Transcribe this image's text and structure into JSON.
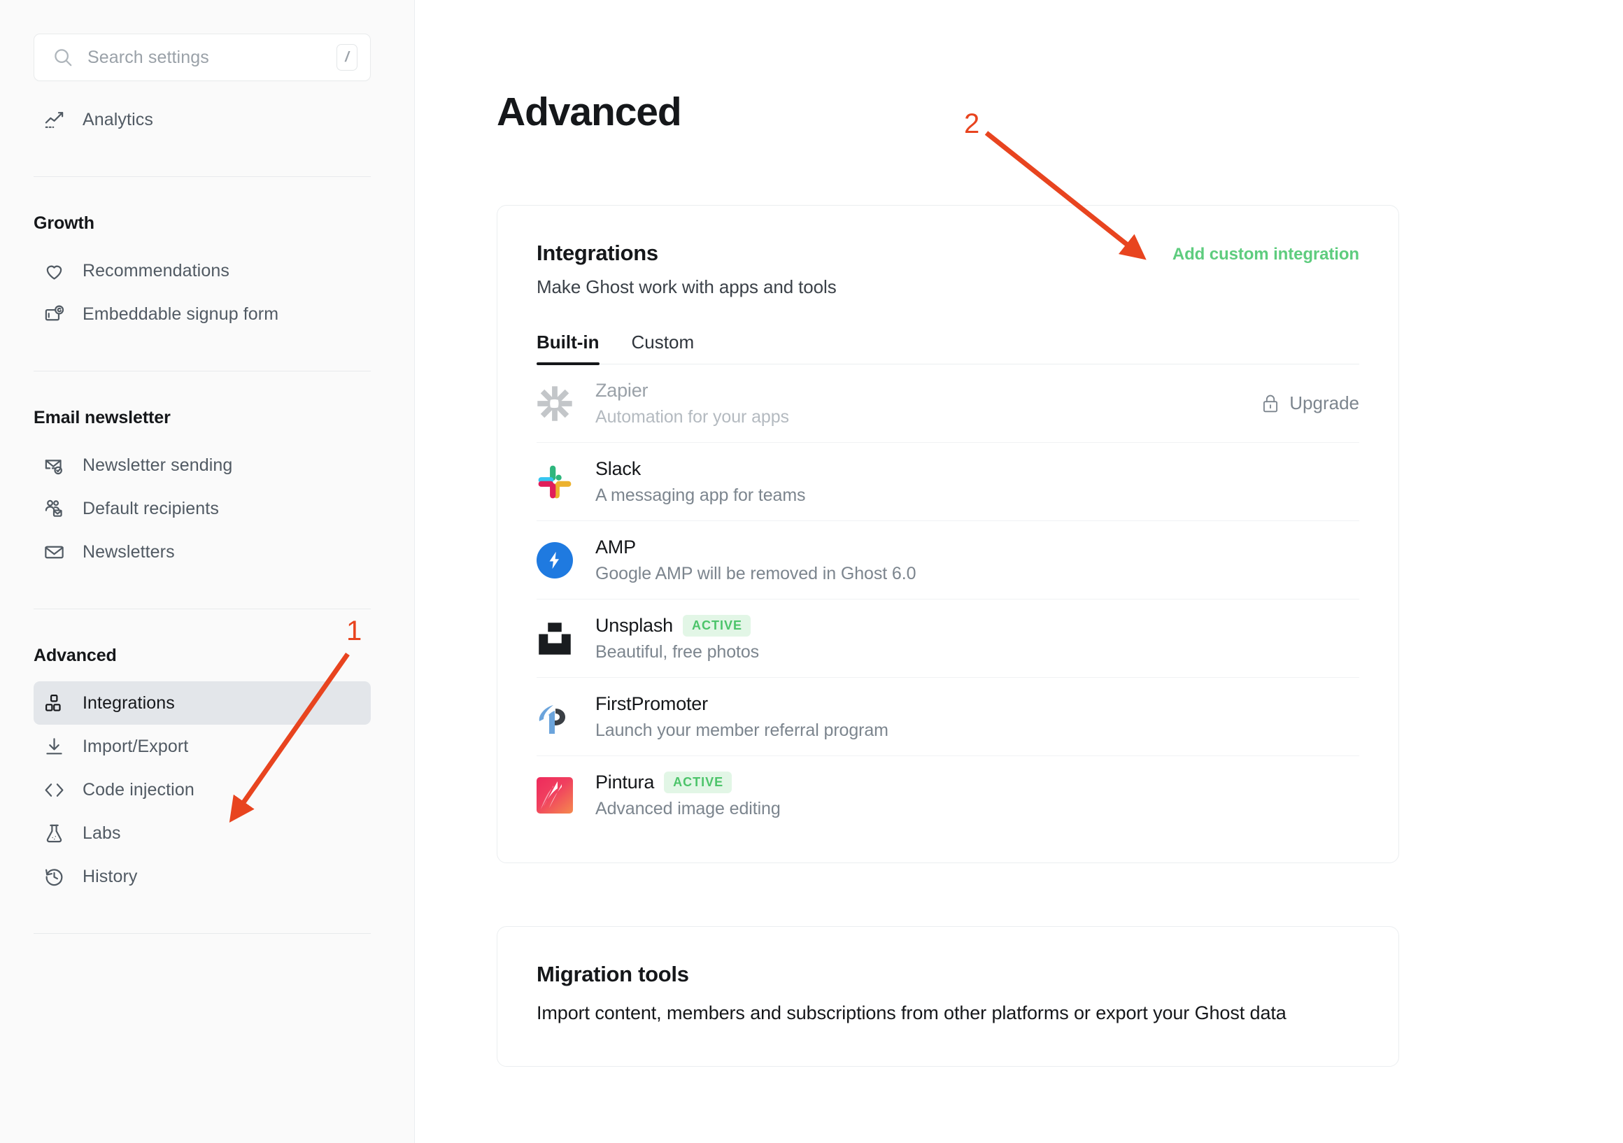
{
  "search": {
    "placeholder": "Search settings",
    "shortcut_key": "/",
    "icon": "search-icon"
  },
  "sidebar": {
    "top_items": [
      {
        "label": "Analytics",
        "icon": "analytics-chart-icon"
      }
    ],
    "sections": [
      {
        "title": "Growth",
        "items": [
          {
            "label": "Recommendations",
            "icon": "heart-icon"
          },
          {
            "label": "Embeddable signup form",
            "icon": "signup-form-icon"
          }
        ]
      },
      {
        "title": "Email newsletter",
        "items": [
          {
            "label": "Newsletter sending",
            "icon": "envelope-check-icon"
          },
          {
            "label": "Default recipients",
            "icon": "users-envelope-icon"
          },
          {
            "label": "Newsletters",
            "icon": "envelope-icon"
          }
        ]
      },
      {
        "title": "Advanced",
        "items": [
          {
            "label": "Integrations",
            "icon": "blocks-icon",
            "selected": true
          },
          {
            "label": "Import/Export",
            "icon": "download-icon"
          },
          {
            "label": "Code injection",
            "icon": "code-brackets-icon"
          },
          {
            "label": "Labs",
            "icon": "flask-icon"
          },
          {
            "label": "History",
            "icon": "clock-rewind-icon"
          }
        ]
      }
    ]
  },
  "main": {
    "page_title": "Advanced",
    "integrations_card": {
      "title": "Integrations",
      "subtitle": "Make Ghost work with apps and tools",
      "action_label": "Add custom integration",
      "action_color": "#5ecc7e",
      "tabs": [
        {
          "label": "Built-in",
          "active": true
        },
        {
          "label": "Custom",
          "active": false
        }
      ],
      "rows": [
        {
          "name": "Zapier",
          "description": "Automation for your apps",
          "icon": "zapier-logo",
          "disabled": true,
          "badge": "",
          "right_label": "Upgrade",
          "right_icon": "lock-icon"
        },
        {
          "name": "Slack",
          "description": "A messaging app for teams",
          "icon": "slack-logo",
          "disabled": false,
          "badge": "",
          "right_label": "",
          "right_icon": ""
        },
        {
          "name": "AMP",
          "description": "Google AMP will be removed in Ghost 6.0",
          "icon": "amp-logo",
          "disabled": false,
          "badge": "",
          "right_label": "",
          "right_icon": ""
        },
        {
          "name": "Unsplash",
          "description": "Beautiful, free photos",
          "icon": "unsplash-logo",
          "disabled": false,
          "badge": "ACTIVE",
          "right_label": "",
          "right_icon": ""
        },
        {
          "name": "FirstPromoter",
          "description": "Launch your member referral program",
          "icon": "firstpromoter-logo",
          "disabled": false,
          "badge": "",
          "right_label": "",
          "right_icon": ""
        },
        {
          "name": "Pintura",
          "description": "Advanced image editing",
          "icon": "pintura-logo",
          "disabled": false,
          "badge": "ACTIVE",
          "right_label": "",
          "right_icon": ""
        }
      ]
    },
    "migration_card": {
      "title": "Migration tools",
      "subtitle": "Import content, members and subscriptions from other platforms or export your Ghost data"
    }
  },
  "annotations": [
    {
      "number": "1",
      "target": "sidebar-item-integrations",
      "color": "#e8441f"
    },
    {
      "number": "2",
      "target": "add-custom-integration-button",
      "color": "#e8441f"
    }
  ]
}
